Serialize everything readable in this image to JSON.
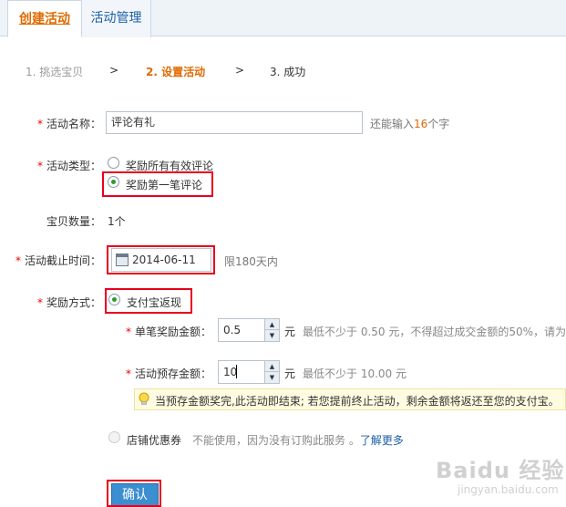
{
  "tabs": [
    {
      "label": "创建活动"
    },
    {
      "label": "活动管理"
    }
  ],
  "steps": {
    "step1": "1. 挑选宝贝",
    "arrow": ">",
    "step2": "2. 设置活动",
    "step3": "3. 成功"
  },
  "form": {
    "required_mark": "*",
    "name": {
      "label": "活动名称：",
      "value": "评论有礼",
      "hint_prefix": "还能输入",
      "hint_count": "16",
      "hint_suffix": "个字"
    },
    "type": {
      "label": "活动类型：",
      "options": [
        "奖励所有有效评论",
        "奖励第一笔评论"
      ],
      "selected": "奖励第一笔评论"
    },
    "quantity": {
      "label": "宝贝数量：",
      "value": "1个"
    },
    "deadline": {
      "label": "活动截止时间：",
      "value": "2014-06-11",
      "hint": "限180天内"
    },
    "reward": {
      "label": "奖励方式：",
      "alipay_option": "支付宝返现",
      "single_amount_label": "单笔奖励金额：",
      "single_amount_value": "0.5",
      "single_amount_unit": "元",
      "single_amount_hint": "最低不少于 0.50 元，不得超过成交金额的50%，请为",
      "prepay_label": "活动预存金额：",
      "prepay_value": "10",
      "prepay_unit": "元",
      "prepay_hint": "最低不少于 10.00 元",
      "tip": "当预存金额奖完,此活动即结束; 若您提前终止活动，剩余金额将返还至您的支付宝。",
      "coupon_option": "店铺优惠券",
      "coupon_note": "不能使用，因为没有订购此服务 。",
      "coupon_link": "了解更多"
    }
  },
  "confirm_button": "确认",
  "watermark": {
    "main": "Baidu 经验",
    "sub": "jingyan.baidu.com"
  },
  "colors": {
    "accent_orange": "#e06a00",
    "link_blue": "#1a5fa8",
    "highlight_red": "#e8001c",
    "button_blue": "#3b8ed0"
  }
}
